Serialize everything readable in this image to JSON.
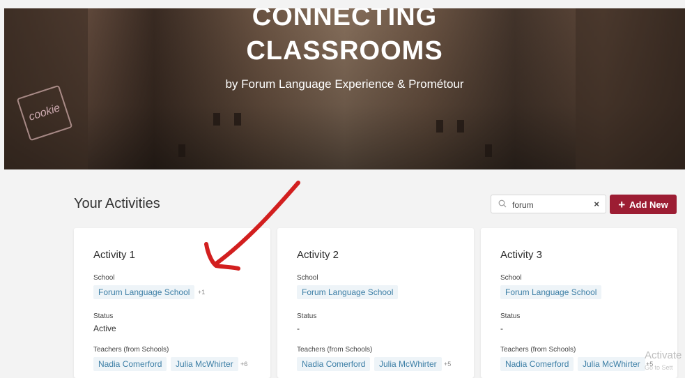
{
  "hero": {
    "title_line1": "CONNECTING",
    "title_line2": "CLASSROOMS",
    "subtitle": "by Forum Language Experience & Prométour",
    "sign_text": "cookie"
  },
  "section": {
    "title": "Your Activities"
  },
  "search": {
    "value": "forum",
    "clear_symbol": "×"
  },
  "add_button": {
    "icon": "+",
    "label": "Add New"
  },
  "cards": [
    {
      "title": "Activity 1",
      "school_label": "School",
      "school": "Forum Language School",
      "school_more": "+1",
      "status_label": "Status",
      "status": "Active",
      "teachers_label": "Teachers (from Schools)",
      "teachers": [
        "Nadia Comerford",
        "Julia McWhirter"
      ],
      "teachers_more": "+6"
    },
    {
      "title": "Activity 2",
      "school_label": "School",
      "school": "Forum Language School",
      "school_more": "",
      "status_label": "Status",
      "status": "-",
      "teachers_label": "Teachers (from Schools)",
      "teachers": [
        "Nadia Comerford",
        "Julia McWhirter"
      ],
      "teachers_more": "+5"
    },
    {
      "title": "Activity 3",
      "school_label": "School",
      "school": "Forum Language School",
      "school_more": "",
      "status_label": "Status",
      "status": "-",
      "teachers_label": "Teachers (from Schools)",
      "teachers": [
        "Nadia Comerford",
        "Julia McWhirter"
      ],
      "teachers_more": "+5"
    }
  ],
  "os_watermark": {
    "line1": "Activate",
    "line2": "Go to Sett"
  },
  "colors": {
    "accent": "#9c1d33",
    "chip_text": "#3d7fa6",
    "chip_bg": "#eef4f8",
    "annotation_arrow": "#d21f1f"
  }
}
